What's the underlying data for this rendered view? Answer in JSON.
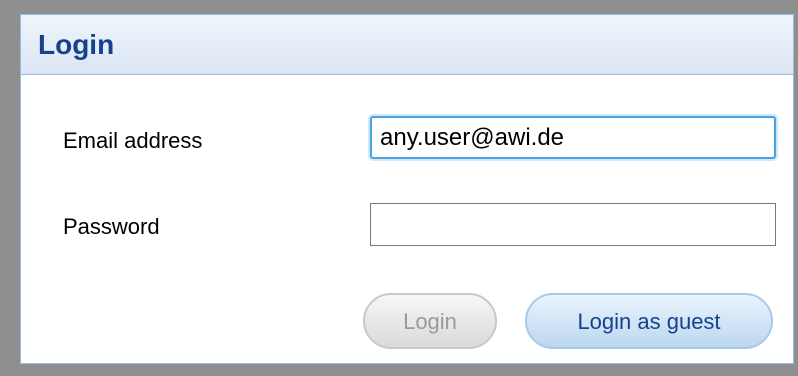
{
  "dialog": {
    "title": "Login"
  },
  "form": {
    "email_label": "Email address",
    "email_value": "any.user@awi.de",
    "password_label": "Password",
    "password_value": ""
  },
  "buttons": {
    "login_label": "Login",
    "guest_label": "Login as guest"
  },
  "colors": {
    "title_text": "#15428b",
    "focus_ring": "#4aa3df",
    "disabled_text": "#9a9a9a"
  }
}
